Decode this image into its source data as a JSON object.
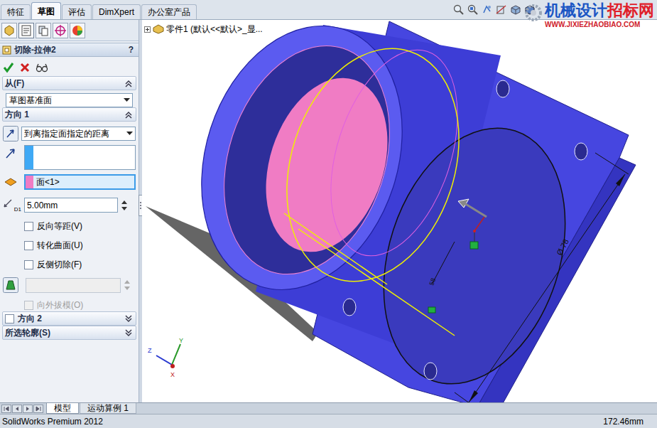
{
  "ribbon_tabs": [
    {
      "label": "特征",
      "selected": false
    },
    {
      "label": "草图",
      "selected": true
    },
    {
      "label": "评估",
      "selected": false
    },
    {
      "label": "DimXpert",
      "selected": false
    },
    {
      "label": "办公室产品",
      "selected": false
    }
  ],
  "watermark": {
    "title_blue": "机械设计",
    "title_red": "招标网",
    "url": "WWW.JIXIEZHAOBIAO.COM"
  },
  "tree": {
    "label": "零件1 (默认<<默认>_显..."
  },
  "property_manager": {
    "title": "切除-拉伸2",
    "help": "?"
  },
  "from_section": {
    "label": "从(F)",
    "expanded": true,
    "value": "草图基准面"
  },
  "direction1": {
    "label": "方向 1",
    "expanded": true,
    "end_condition": "到离指定面指定的距离",
    "direction_field": "",
    "face_field": "面<1>",
    "distance_symbol": "D1",
    "distance": "5.00mm",
    "options": [
      {
        "label": "反向等距(V)",
        "checked": false,
        "disabled": false
      },
      {
        "label": "转化曲面(U)",
        "checked": false,
        "disabled": false
      },
      {
        "label": "反侧切除(F)",
        "checked": false,
        "disabled": false
      }
    ],
    "draft_angle": "",
    "draft_outward": {
      "label": "向外拔模(O)",
      "checked": false,
      "disabled": true
    }
  },
  "direction2": {
    "label": "方向 2",
    "checked": false,
    "expanded": false
  },
  "selected_contours": {
    "label": "所选轮廓(S)",
    "expanded": false
  },
  "dimensions": [
    {
      "text": "Ø 78"
    },
    {
      "text": "58"
    }
  ],
  "triad": {
    "x": "X",
    "y": "Y",
    "z": "Z"
  },
  "bottom_tabs": [
    {
      "label": "模型",
      "selected": true
    },
    {
      "label": "运动算例 1",
      "selected": false
    }
  ],
  "status_bar": {
    "app": "SolidWorks Premium 2012",
    "measure": "172.46mm"
  }
}
